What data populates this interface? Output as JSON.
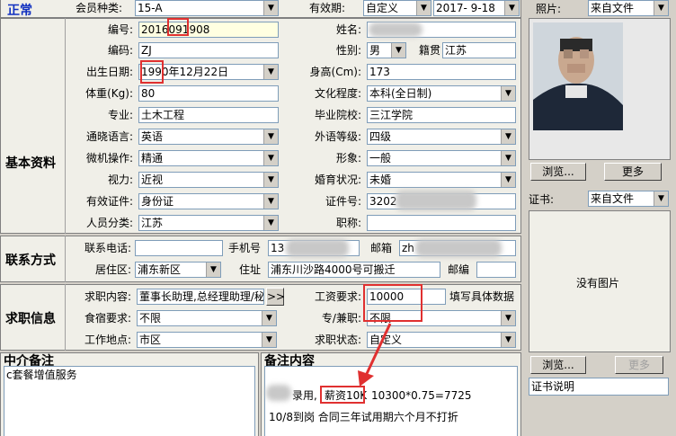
{
  "top": {
    "status": "正常",
    "member_type_label": "会员种类:",
    "member_type_value": "15-A",
    "valid_label": "有效期:",
    "valid_type": "自定义",
    "valid_date": "2017- 9-18",
    "photo_label": "照片:",
    "photo_source": "来自文件"
  },
  "basic": {
    "section_title": "基本资料",
    "number_label": "编号:",
    "number_value": "2016091908",
    "name_label": "姓名:",
    "name_value": "",
    "code_label": "编码:",
    "code_value": "ZJ",
    "gender_label": "性别:",
    "gender_value": "男",
    "native_label": "籍贯",
    "native_value": "江苏",
    "birth_label": "出生日期:",
    "birth_value": "1990年12月22日",
    "height_label": "身高(Cm):",
    "height_value": "173",
    "weight_label": "体重(Kg):",
    "weight_value": "80",
    "edu_label": "文化程度:",
    "edu_value": "本科(全日制)",
    "major_label": "专业:",
    "major_value": "土木工程",
    "school_label": "毕业院校:",
    "school_value": "三江学院",
    "lang_label": "通晓语言:",
    "lang_value": "英语",
    "foreign_label": "外语等级:",
    "foreign_value": "四级",
    "computer_label": "微机操作:",
    "computer_value": "精通",
    "image_label": "形象:",
    "image_value": "一般",
    "vision_label": "视力:",
    "vision_value": "近视",
    "marital_label": "婚育状况:",
    "marital_value": "未婚",
    "id_type_label": "有效证件:",
    "id_type_value": "身份证",
    "id_no_label": "证件号:",
    "id_no_value": "3202",
    "category_label": "人员分类:",
    "category_value": "江苏",
    "title_label": "职称:",
    "title_value": ""
  },
  "contact": {
    "section_title": "联系方式",
    "phone_label": "联系电话:",
    "phone_value": "",
    "mobile_label": "手机号",
    "mobile_value": "13",
    "email_label": "邮箱",
    "email_value": "zh",
    "district_label": "居住区:",
    "district_value": "浦东新区",
    "address_label": "住址",
    "address_value": "浦东川沙路4000号可搬迁",
    "postcode_label": "邮编",
    "postcode_value": ""
  },
  "job": {
    "section_title": "求职信息",
    "wanted_label": "求职内容:",
    "wanted_value": "董事长助理,总经理助理/秘",
    "more_button": ">>",
    "salary_label": "工资要求:",
    "salary_value": "10000",
    "salary_hint": "填写具体数据",
    "board_label": "食宿要求:",
    "board_value": "不限",
    "fulltime_label": "专/兼职:",
    "fulltime_value": "不限",
    "location_label": "工作地点:",
    "location_value": "市区",
    "state_label": "求职状态:",
    "state_value": "自定义"
  },
  "agency": {
    "title": "中介备注",
    "text": "c套餐增值服务"
  },
  "remarks": {
    "title": "备注内容",
    "line1_prefix": "录用,",
    "line1_salary": "薪资10K",
    "line1_calc": "10300*0.75=7725",
    "line2": "10/8到岗 合同三年试用期六个月不打折"
  },
  "photo": {
    "browse_button": "浏览...",
    "more_button": "更多"
  },
  "cert": {
    "label": "证书:",
    "source": "来自文件",
    "no_image": "没有图片",
    "browse_button": "浏览...",
    "more_button": "更多",
    "desc": "证书说明"
  }
}
